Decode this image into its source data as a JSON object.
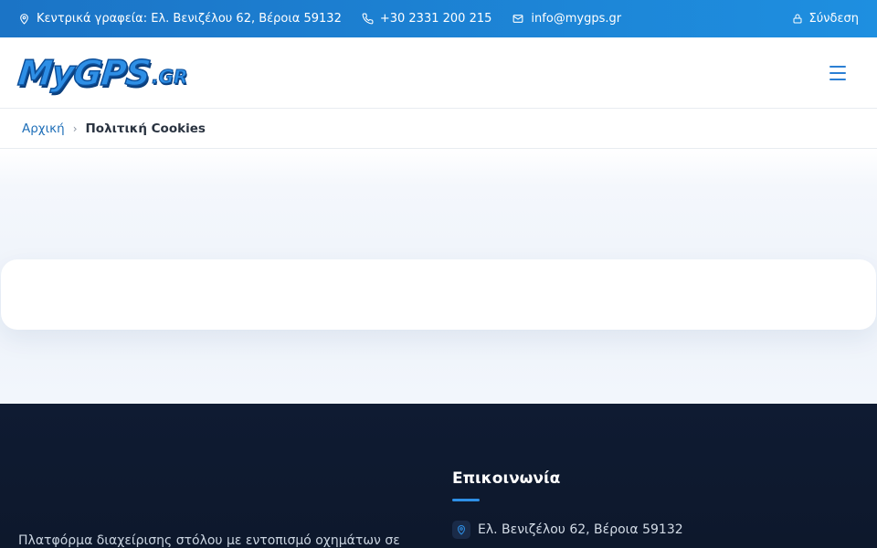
{
  "topbar": {
    "address": "Κεντρικά γραφεία: Ελ. Βενιζέλου 62, Βέροια 59132",
    "phone": "+30 2331 200 215",
    "email": "info@mygps.gr",
    "login": "Σύνδεση",
    "icons": [
      "map-pin-icon",
      "phone-icon",
      "mail-icon",
      "lock-icon"
    ]
  },
  "header": {
    "logo_main": "MyGPS",
    "logo_suffix": ".GR",
    "menu_icon": "hamburger-menu-icon"
  },
  "breadcrumb": {
    "home": "Αρχική",
    "separator": "›",
    "current": "Πολιτική Cookies"
  },
  "footer": {
    "description": "Πλατφόρμα διαχείρισης στόλου με εντοπισμό οχημάτων σε",
    "contact_title": "Επικοινωνία",
    "contact_address": "Ελ. Βενιζέλου 62, Βέροια 59132"
  },
  "colors": {
    "topbar": "#1b74c6",
    "accent": "#2e8fe6",
    "footer_bg": "#0f1b32",
    "link": "#1f6fb8"
  }
}
